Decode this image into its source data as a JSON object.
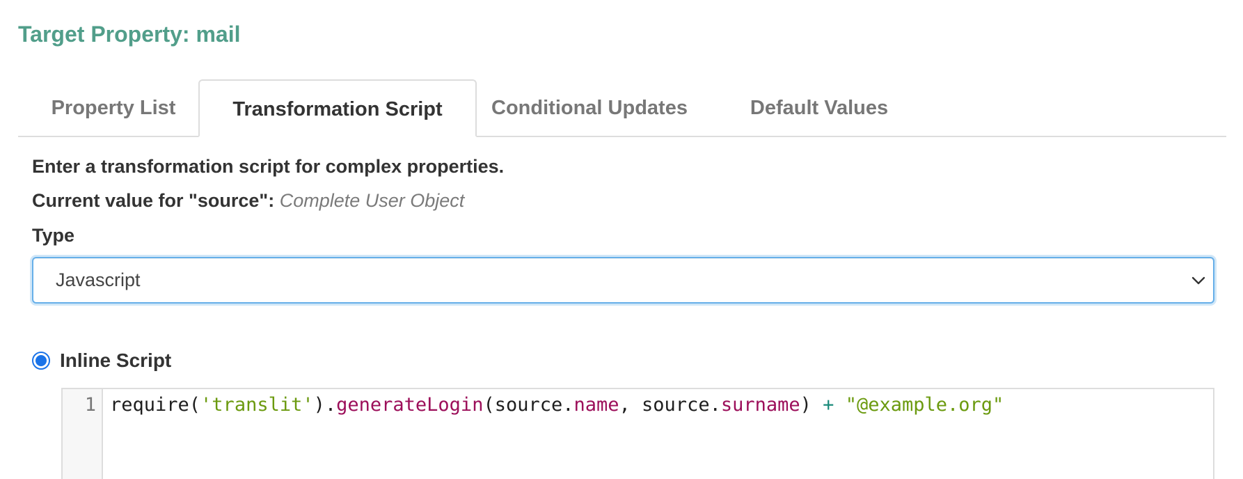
{
  "header": {
    "title": "Target Property: mail"
  },
  "tabs": [
    {
      "label": "Property List",
      "active": false
    },
    {
      "label": "Transformation Script",
      "active": true
    },
    {
      "label": "Conditional Updates",
      "active": false
    },
    {
      "label": "Default Values",
      "active": false
    }
  ],
  "form": {
    "intro": "Enter a transformation script for complex properties.",
    "current_value_label": "Current value for \"source\":",
    "current_value": "Complete User Object",
    "type_label": "Type",
    "type_selected": "Javascript",
    "radio_label": "Inline Script",
    "radio_checked": true
  },
  "editor": {
    "line_number": "1",
    "tokens": [
      {
        "text": "require(",
        "kind": "plain"
      },
      {
        "text": "'translit'",
        "kind": "string"
      },
      {
        "text": ").",
        "kind": "plain"
      },
      {
        "text": "generateLogin",
        "kind": "prop"
      },
      {
        "text": "(source.",
        "kind": "plain"
      },
      {
        "text": "name",
        "kind": "prop"
      },
      {
        "text": ", source.",
        "kind": "plain"
      },
      {
        "text": "surname",
        "kind": "prop"
      },
      {
        "text": ") ",
        "kind": "plain"
      },
      {
        "text": "+",
        "kind": "op"
      },
      {
        "text": " ",
        "kind": "plain"
      },
      {
        "text": "\"@example.org\"",
        "kind": "string"
      }
    ]
  },
  "colors": {
    "title": "#519e8a",
    "focus_border": "#66afe9",
    "radio": "#1a73e8",
    "string": "#6b9a0f",
    "property": "#9c0f5a",
    "operator": "#1a8a7a"
  },
  "icons": {
    "select_caret": "chevron-down-icon"
  }
}
